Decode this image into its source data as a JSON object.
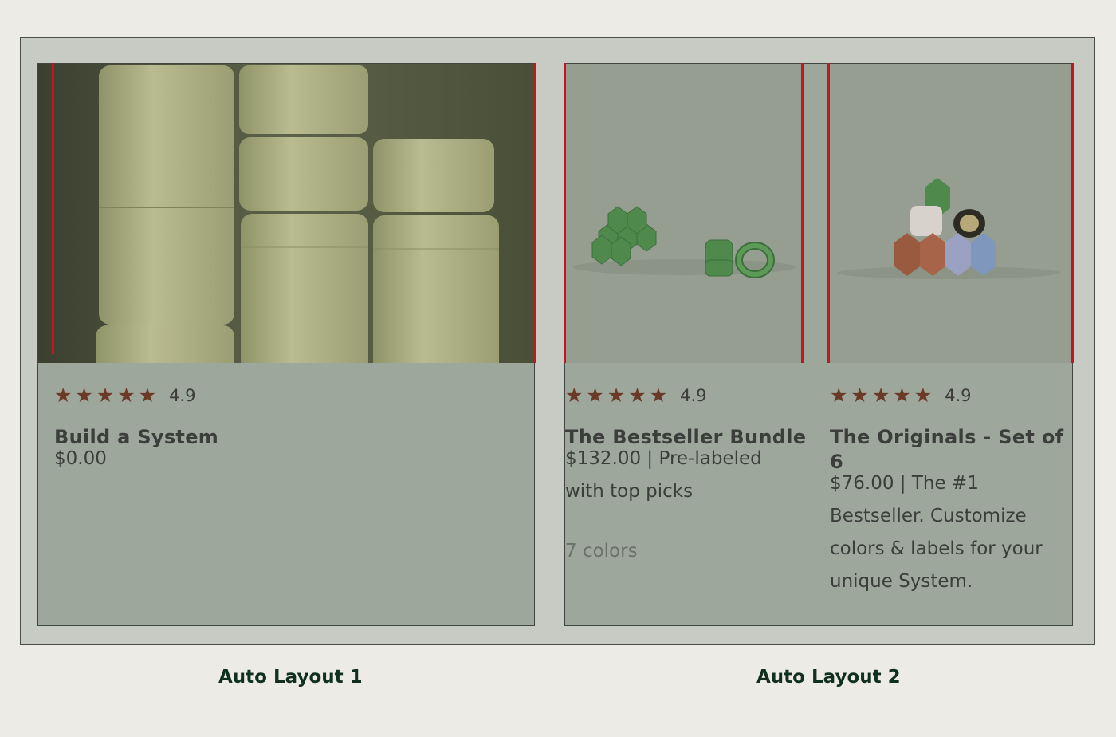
{
  "cards": [
    {
      "rating": "4.9",
      "title": "Build a System",
      "price": "$0.00"
    },
    {
      "rating": "4.9",
      "title": "The Bestseller Bundle",
      "desc_line1": "$132.00 | Pre-labeled",
      "desc_line2": "with top picks",
      "colors": "7 colors"
    },
    {
      "rating": "4.9",
      "title_line1": "The Originals - Set of",
      "title_line2": "6",
      "desc_line1": "$76.00 | The #1",
      "desc_line2": "Bestseller. Customize",
      "desc_line3": "colors & labels for your",
      "desc_line4": "unique System."
    }
  ],
  "stars_glyph": "★",
  "captions": {
    "layout1": "Auto Layout 1",
    "layout2": "Auto Layout 2"
  },
  "colors": {
    "accent_red": "#c4171d",
    "star": "#6a3a26",
    "caption": "#123022"
  }
}
